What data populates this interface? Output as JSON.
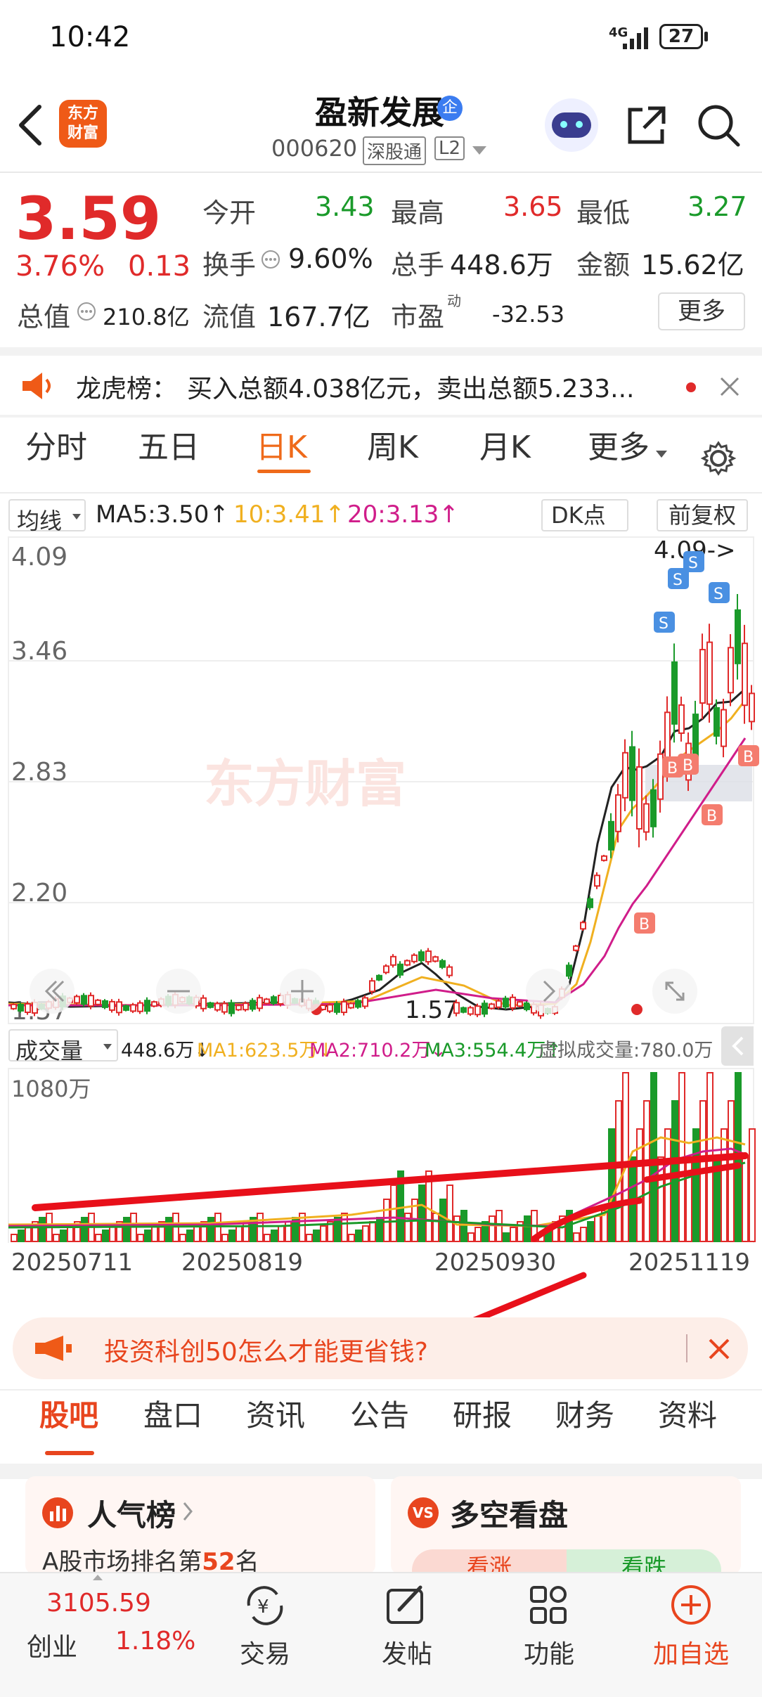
{
  "status_bar": {
    "time": "10:42",
    "network": "4G",
    "battery": "27"
  },
  "header": {
    "logo_text_1": "东方",
    "logo_text_2": "财富",
    "stock_name": "盈新发展",
    "name_badge": "企",
    "stock_code": "000620",
    "tag_market": "深股通",
    "tag_level": "L2"
  },
  "quote": {
    "price": "3.59",
    "change_pct": "3.76%",
    "change": "0.13",
    "open_label": "今开",
    "open": "3.43",
    "high_label": "最高",
    "high": "3.65",
    "low_label": "最低",
    "low": "3.27",
    "turnover_label": "换手",
    "turnover": "9.60%",
    "volume_label": "总手",
    "volume": "448.6万",
    "amount_label": "金额",
    "amount": "15.62亿",
    "mktcap_label": "总值",
    "mktcap": "210.8亿",
    "float_label": "流值",
    "float": "167.7亿",
    "pe_label": "市盈",
    "pe_sup": "动",
    "pe": "-32.53",
    "more_button": "更多"
  },
  "notice": {
    "label": "龙虎榜：",
    "text": "买入总额4.038亿元，卖出总额5.233..."
  },
  "chart_tabs": [
    "分时",
    "五日",
    "日K",
    "周K",
    "月K",
    "更多"
  ],
  "active_chart_tab": "日K",
  "ma_bar": {
    "selector": "均线",
    "ma5": "MA5:3.50↑",
    "ma10": "10:3.41↑",
    "ma20": "20:3.13↑",
    "dk_button": "DK点",
    "adjust_button": "前复权"
  },
  "kline": {
    "price_ticks": [
      "4.09",
      "3.46",
      "2.83",
      "2.20",
      "1.57"
    ],
    "max_label": "4.09->",
    "min_label": "1.57",
    "watermark": "东方财富",
    "buy_marker": "B",
    "sell_marker": "S"
  },
  "volume_bar": {
    "selector": "成交量",
    "vol": "448.6万↓",
    "ma1": "MA1:623.5万↓",
    "ma2": "MA2:710.2万↓",
    "ma3": "MA3:554.4万↑",
    "virtual": "虚拟成交量:780.0万",
    "max_label": "1080万"
  },
  "dates": [
    "20250711",
    "20250819",
    "20250930",
    "20251119"
  ],
  "ad_banner": {
    "text": "投资科创50怎么才能更省钱?"
  },
  "section_tabs": [
    "股吧",
    "盘口",
    "资讯",
    "公告",
    "研报",
    "财务",
    "资料"
  ],
  "active_section_tab": "股吧",
  "cards": {
    "popularity_title": "人气榜",
    "popularity_text_prefix": "A股市场排名第",
    "popularity_rank": "52",
    "popularity_text_suffix": "名",
    "longshort_title": "多空看盘",
    "bull": "看涨",
    "bear": "看跌"
  },
  "bottom_nav": {
    "index_value": "3105.59",
    "index_name": "创业",
    "index_change": "1.18%",
    "trade": "交易",
    "post": "发帖",
    "functions": "功能",
    "add_watch": "加自选"
  }
}
